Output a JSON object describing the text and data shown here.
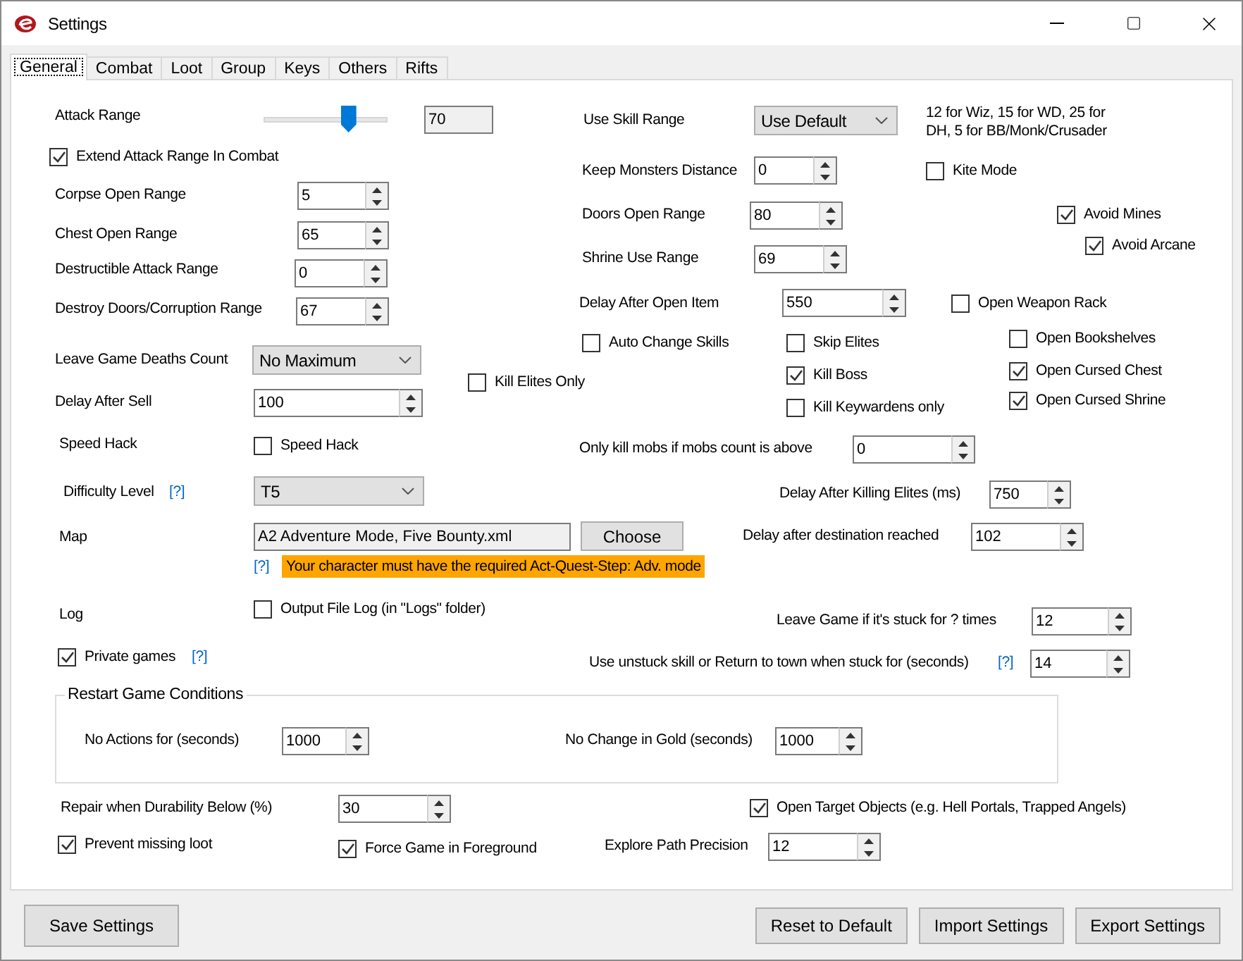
{
  "window": {
    "title": "Settings"
  },
  "tabs": [
    {
      "label": "General",
      "selected": true
    },
    {
      "label": "Combat",
      "selected": false
    },
    {
      "label": "Loot",
      "selected": false
    },
    {
      "label": "Group",
      "selected": false
    },
    {
      "label": "Keys",
      "selected": false
    },
    {
      "label": "Others",
      "selected": false
    },
    {
      "label": "Rifts",
      "selected": false
    }
  ],
  "controls": [
    {
      "kind": "label",
      "text": "Attack Range"
    },
    {
      "kind": "slider",
      "level": 0.68
    },
    {
      "kind": "text",
      "value": "70",
      "readonly": true
    },
    {
      "kind": "label",
      "text": "Use Skill Range"
    },
    {
      "kind": "combo",
      "value": "Use Default"
    },
    {
      "kind": "note",
      "text": "12 for Wiz, 15 for WD, 25 for DH,  5 for BB/Monk/Crusader"
    },
    {
      "kind": "checkbox",
      "label": "Extend Attack Range In Combat",
      "checked": true
    },
    {
      "kind": "label",
      "text": "Keep Monsters Distance"
    },
    {
      "kind": "spin",
      "value": "0"
    },
    {
      "kind": "checkbox",
      "label": "Kite Mode",
      "checked": false
    },
    {
      "kind": "label",
      "text": "Corpse Open Range"
    },
    {
      "kind": "spin",
      "value": "5"
    },
    {
      "kind": "label",
      "text": "Doors Open Range"
    },
    {
      "kind": "spin",
      "value": "80"
    },
    {
      "kind": "checkbox",
      "label": "Avoid Mines",
      "checked": true
    },
    {
      "kind": "label",
      "text": "Chest Open Range"
    },
    {
      "kind": "spin",
      "value": "65"
    },
    {
      "kind": "checkbox",
      "label": "Avoid Arcane",
      "checked": true
    },
    {
      "kind": "label",
      "text": "Shrine Use Range"
    },
    {
      "kind": "spin",
      "value": "69"
    },
    {
      "kind": "label",
      "text": "Destructible Attack Range"
    },
    {
      "kind": "spin",
      "value": "0"
    },
    {
      "kind": "label",
      "text": "Destroy Doors/Corruption Range"
    },
    {
      "kind": "spin",
      "value": "67"
    },
    {
      "kind": "label",
      "text": "Delay After Open Item"
    },
    {
      "kind": "spin",
      "value": "550"
    },
    {
      "kind": "checkbox",
      "label": "Open Weapon Rack",
      "checked": false
    },
    {
      "kind": "checkbox",
      "label": "Auto Change Skills",
      "checked": false
    },
    {
      "kind": "checkbox",
      "label": "Skip Elites",
      "checked": false
    },
    {
      "kind": "checkbox",
      "label": "Open Bookshelves",
      "checked": false
    },
    {
      "kind": "label",
      "text": "Leave Game Deaths Count"
    },
    {
      "kind": "combo",
      "value": "No Maximum"
    },
    {
      "kind": "checkbox",
      "label": "Kill Boss",
      "checked": true
    },
    {
      "kind": "checkbox",
      "label": "Open Cursed Chest",
      "checked": true
    },
    {
      "kind": "checkbox",
      "label": "Kill Elites Only",
      "checked": false
    },
    {
      "kind": "label",
      "text": "Delay After Sell"
    },
    {
      "kind": "spin",
      "value": "100"
    },
    {
      "kind": "checkbox",
      "label": "Kill Keywardens only",
      "checked": false
    },
    {
      "kind": "checkbox",
      "label": "Open Cursed Shrine",
      "checked": true
    },
    {
      "kind": "label",
      "text": "Speed Hack"
    },
    {
      "kind": "checkbox",
      "label": "Speed Hack",
      "checked": false
    },
    {
      "kind": "label",
      "text": "Only kill mobs if mobs count is above"
    },
    {
      "kind": "spin",
      "value": "0"
    },
    {
      "kind": "label",
      "text": "Difficulty Level"
    },
    {
      "kind": "help",
      "text": "[?]"
    },
    {
      "kind": "combo",
      "value": "T5"
    },
    {
      "kind": "label",
      "text": "Delay After Killing Elites (ms)"
    },
    {
      "kind": "spin",
      "value": "750"
    },
    {
      "kind": "label",
      "text": "Map"
    },
    {
      "kind": "text",
      "value": "A2 Adventure Mode, Five Bounty.xml",
      "readonly": true
    },
    {
      "kind": "button",
      "text": "Choose"
    },
    {
      "kind": "label",
      "text": "Delay after destination reached"
    },
    {
      "kind": "spin",
      "value": "102"
    },
    {
      "kind": "help",
      "text": "[?]"
    },
    {
      "kind": "warning",
      "text": "Your character must have the required Act-Quest-Step: Adv. mode"
    },
    {
      "kind": "label",
      "text": "Log"
    },
    {
      "kind": "checkbox",
      "label": "Output File Log (in \"Logs\" folder)",
      "checked": false
    },
    {
      "kind": "label",
      "text": "Leave Game if it's stuck for ? times"
    },
    {
      "kind": "spin",
      "value": "12"
    },
    {
      "kind": "checkbox",
      "label": "Private games",
      "checked": true
    },
    {
      "kind": "help",
      "text": "[?]"
    },
    {
      "kind": "label",
      "text": "Use unstuck skill or Return to town when stuck for (seconds)"
    },
    {
      "kind": "help",
      "text": "[?]"
    },
    {
      "kind": "spin",
      "value": "14"
    },
    {
      "kind": "group",
      "title": "Restart Game Conditions"
    },
    {
      "kind": "label",
      "text": "No Actions for (seconds)"
    },
    {
      "kind": "spin",
      "value": "1000"
    },
    {
      "kind": "label",
      "text": "No Change in Gold (seconds)"
    },
    {
      "kind": "spin",
      "value": "1000"
    },
    {
      "kind": "label",
      "text": "Repair when Durability Below (%)"
    },
    {
      "kind": "spin",
      "value": "30"
    },
    {
      "kind": "checkbox",
      "label": "Open Target Objects (e.g. Hell Portals, Trapped Angels)",
      "checked": true
    },
    {
      "kind": "checkbox",
      "label": "Prevent missing loot",
      "checked": true
    },
    {
      "kind": "checkbox",
      "label": "Force Game in Foreground",
      "checked": true
    },
    {
      "kind": "label",
      "text": "Explore Path Precision"
    },
    {
      "kind": "spin",
      "value": "12"
    }
  ],
  "footer": {
    "left": [
      "Save Settings"
    ],
    "right": [
      "Reset to Default",
      "Import Settings",
      "Export Settings"
    ]
  }
}
